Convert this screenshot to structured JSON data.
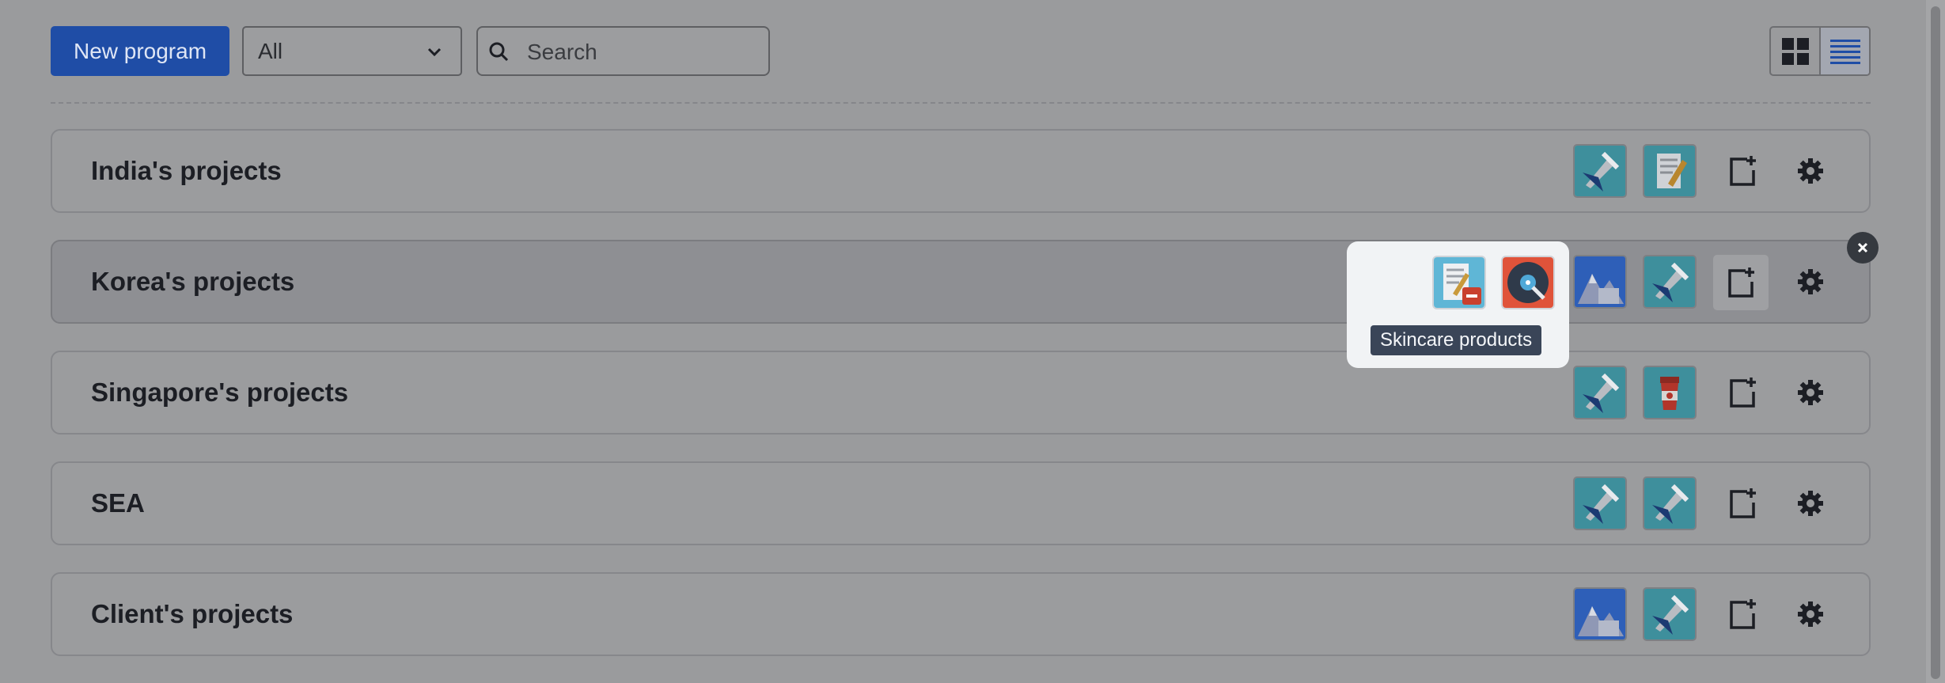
{
  "toolbar": {
    "new_program_label": "New program",
    "filter_selected": "All",
    "search_placeholder": "Search"
  },
  "programs": [
    {
      "title": "India's projects",
      "tiles": [
        "pencil-plane-icon",
        "notebook-pencil-icon"
      ]
    },
    {
      "title": "Korea's projects",
      "tiles": [
        "mountain-icon",
        "pencil-plane-icon"
      ]
    },
    {
      "title": "Singapore's projects",
      "tiles": [
        "pencil-plane-icon",
        "coffee-cup-icon"
      ]
    },
    {
      "title": "SEA",
      "tiles": [
        "pencil-plane-icon",
        "pencil-plane-icon"
      ]
    },
    {
      "title": "Client's projects",
      "tiles": [
        "mountain-icon",
        "pencil-plane-icon"
      ]
    }
  ],
  "popover": {
    "icons": [
      "notebook-remove-icon",
      "vinyl-record-icon"
    ],
    "tooltip": "Skincare products"
  },
  "colors": {
    "primary_button": "#1f4da6",
    "overlay_background": "#9a9b9d",
    "tooltip_background": "#3a4558",
    "tile_teal": "#3e8f9c",
    "tile_blue": "#2e5fb8",
    "tile_orange": "#e0533a"
  }
}
